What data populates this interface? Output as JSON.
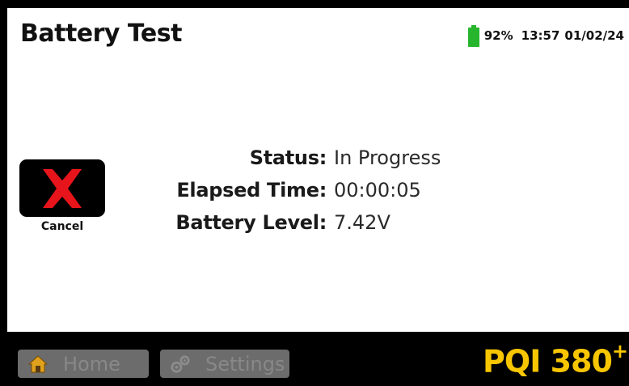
{
  "header": {
    "title": "Battery Test",
    "battery_percent": "92%",
    "time": "13:57",
    "date": "01/02/24",
    "battery_color": "#27b52e"
  },
  "cancel": {
    "label": "Cancel",
    "icon": "red-x-icon",
    "icon_color": "#e8141b"
  },
  "info": [
    {
      "key": "Status:",
      "value": "In Progress"
    },
    {
      "key": "Elapsed Time:",
      "value": "00:00:05"
    },
    {
      "key": "Battery Level:",
      "value": "7.42V"
    }
  ],
  "footer": {
    "home_label": "Home",
    "settings_label": "Settings",
    "brand": "PQI 380",
    "brand_suffix": "+",
    "brand_color": "#f7c600"
  }
}
